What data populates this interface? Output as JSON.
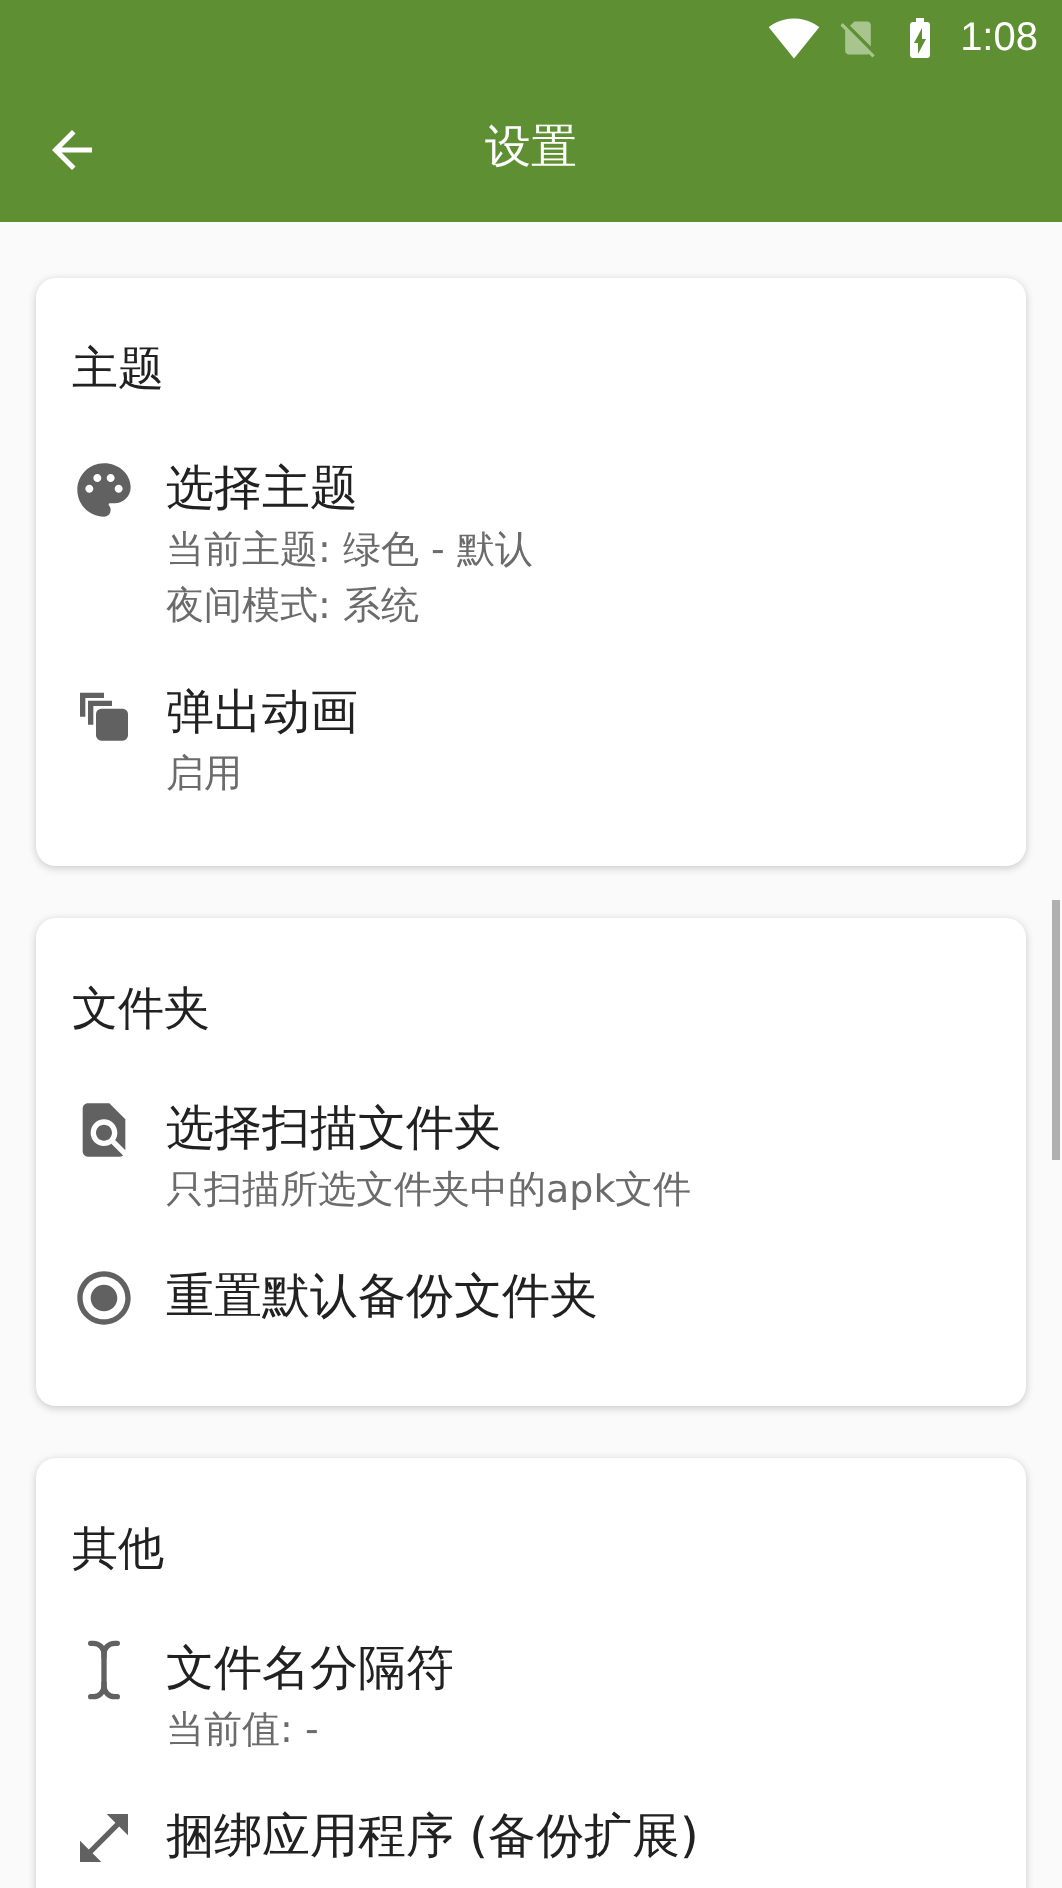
{
  "status_bar": {
    "time": "1:08"
  },
  "app_bar": {
    "title": "设置"
  },
  "sections": [
    {
      "title": "主题",
      "items": [
        {
          "title": "选择主题",
          "subtitles": [
            "当前主题: 绿色 - 默认",
            "夜间模式: 系统"
          ]
        },
        {
          "title": "弹出动画",
          "subtitles": [
            "启用"
          ]
        }
      ]
    },
    {
      "title": "文件夹",
      "items": [
        {
          "title": "选择扫描文件夹",
          "subtitles": [
            "只扫描所选文件夹中的apk文件"
          ]
        },
        {
          "title": "重置默认备份文件夹"
        }
      ]
    },
    {
      "title": "其他",
      "items": [
        {
          "title": "文件名分隔符",
          "subtitles": [
            "当前值: -"
          ]
        },
        {
          "title": "捆绑应用程序 (备份扩展)"
        }
      ]
    }
  ]
}
